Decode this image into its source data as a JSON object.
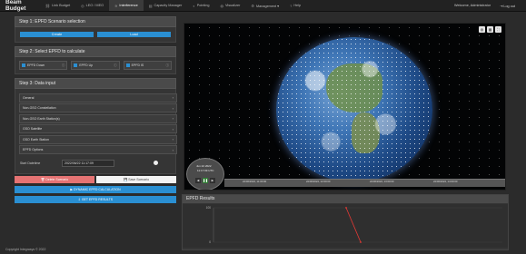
{
  "app": {
    "brand": "Beam Budget"
  },
  "nav": {
    "items": [
      {
        "label": "Link Budget",
        "icon": "link-icon"
      },
      {
        "label": "LEO / MEO",
        "icon": "orbit-icon"
      },
      {
        "label": "Interference",
        "icon": "signal-icon"
      },
      {
        "label": "Capacity Manager",
        "icon": "chart-icon"
      },
      {
        "label": "Pointing",
        "icon": "dish-icon"
      },
      {
        "label": "Visualizer",
        "icon": "globe-icon"
      },
      {
        "label": "Management ▾",
        "icon": "gear-icon"
      },
      {
        "label": "Help",
        "icon": "help-icon"
      }
    ],
    "welcome": "Welcome, Administrator",
    "logout": "Log out"
  },
  "step1": {
    "title": "Step 1: EPFD Scenario selection",
    "create": "Create",
    "load": "Load"
  },
  "step2": {
    "title": "Step 2: Select EPFD to calculate",
    "options": [
      {
        "label": "EPFD Down"
      },
      {
        "label": "EPFD Up"
      },
      {
        "label": "EPFD IS"
      }
    ]
  },
  "step3": {
    "title": "Step 3: Data input",
    "sections": [
      "General",
      "Non-GSO Constellation",
      "Non-GSO Earth Station(s)",
      "GSO Satellite",
      "GSO Earth Station",
      "EPFD Options"
    ],
    "start_label": "Start Datetime",
    "start_value": "2022/06/22 11:17:09",
    "delete_scenario": "Delete Scenario",
    "save_scenario": "Save Scenario",
    "dynamic_calc": "DYNAMIC EPFD CALCULATION",
    "get_results": "GET EPFD RESULTS"
  },
  "viewer": {
    "anim_date": "Jun 22 2022",
    "anim_time": "11:17:09 UTC",
    "ticks": [
      "22/06/2022, 11:00:00",
      "22/06/2022, 12:00:00",
      "22/06/2022, 13:00:00",
      "22/06/2022, 14:00:00"
    ]
  },
  "results": {
    "title": "EPFD Results"
  },
  "chart_data": {
    "type": "line",
    "title": "",
    "ylim": [
      0,
      100
    ],
    "y_ticks": [
      0,
      100
    ],
    "series": [
      {
        "color": "#e53935",
        "points": [
          [
            0,
            100
          ],
          [
            1,
            0
          ]
        ]
      }
    ]
  },
  "footer": "Copyright Integrasys © 2022"
}
